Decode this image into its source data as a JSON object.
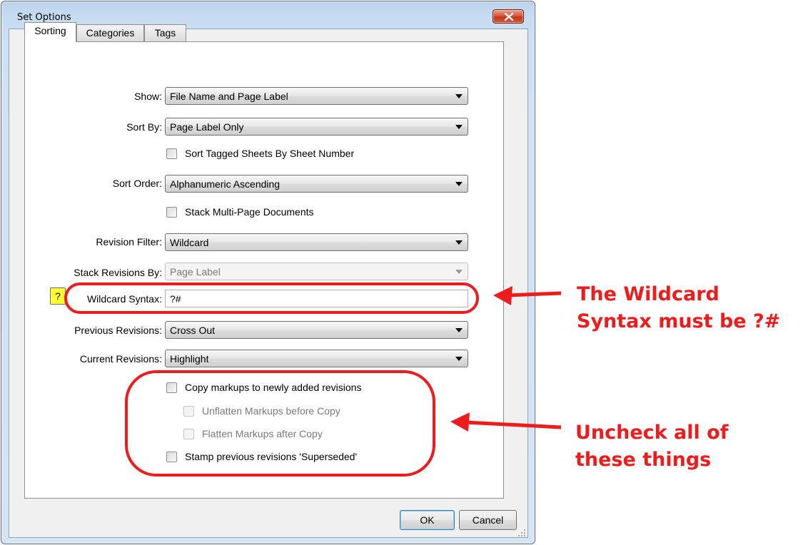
{
  "window": {
    "title": "Set Options"
  },
  "tabs": [
    "Sorting",
    "Categories",
    "Tags"
  ],
  "form": {
    "show": {
      "label": "Show:",
      "value": "File Name and Page Label"
    },
    "sort_by": {
      "label": "Sort By:",
      "value": "Page Label Only"
    },
    "sort_tagged": {
      "label": "Sort Tagged Sheets By Sheet Number",
      "checked": false
    },
    "sort_order": {
      "label": "Sort Order:",
      "value": "Alphanumeric Ascending"
    },
    "stack_multi": {
      "label": "Stack Multi-Page Documents",
      "checked": false
    },
    "revision_filter": {
      "label": "Revision Filter:",
      "value": "Wildcard"
    },
    "stack_revisions": {
      "label": "Stack Revisions By:",
      "value": "Page Label",
      "disabled": true
    },
    "wildcard_syntax": {
      "help": "?",
      "label": "Wildcard Syntax:",
      "value": "?#"
    },
    "previous_revisions": {
      "label": "Previous Revisions:",
      "value": "Cross Out"
    },
    "current_revisions": {
      "label": "Current Revisions:",
      "value": "Highlight"
    },
    "copy_markups": {
      "label": "Copy markups to newly added revisions",
      "checked": false
    },
    "unflatten": {
      "label": "Unflatten Markups before Copy",
      "checked": false,
      "disabled": true
    },
    "flatten": {
      "label": "Flatten Markups after Copy",
      "checked": false,
      "disabled": true
    },
    "stamp_superseded": {
      "label": "Stamp previous revisions 'Superseded'",
      "checked": false
    }
  },
  "buttons": {
    "ok": "OK",
    "cancel": "Cancel"
  },
  "annotations": {
    "wildcard_note": [
      "The Wildcard",
      "Syntax must be ?#"
    ],
    "uncheck_note": [
      "Uncheck all of",
      "these things"
    ],
    "color": "#ee1c1c"
  },
  "icons": {
    "close": "close-x-icon",
    "grip": "resize-grip-icon"
  }
}
